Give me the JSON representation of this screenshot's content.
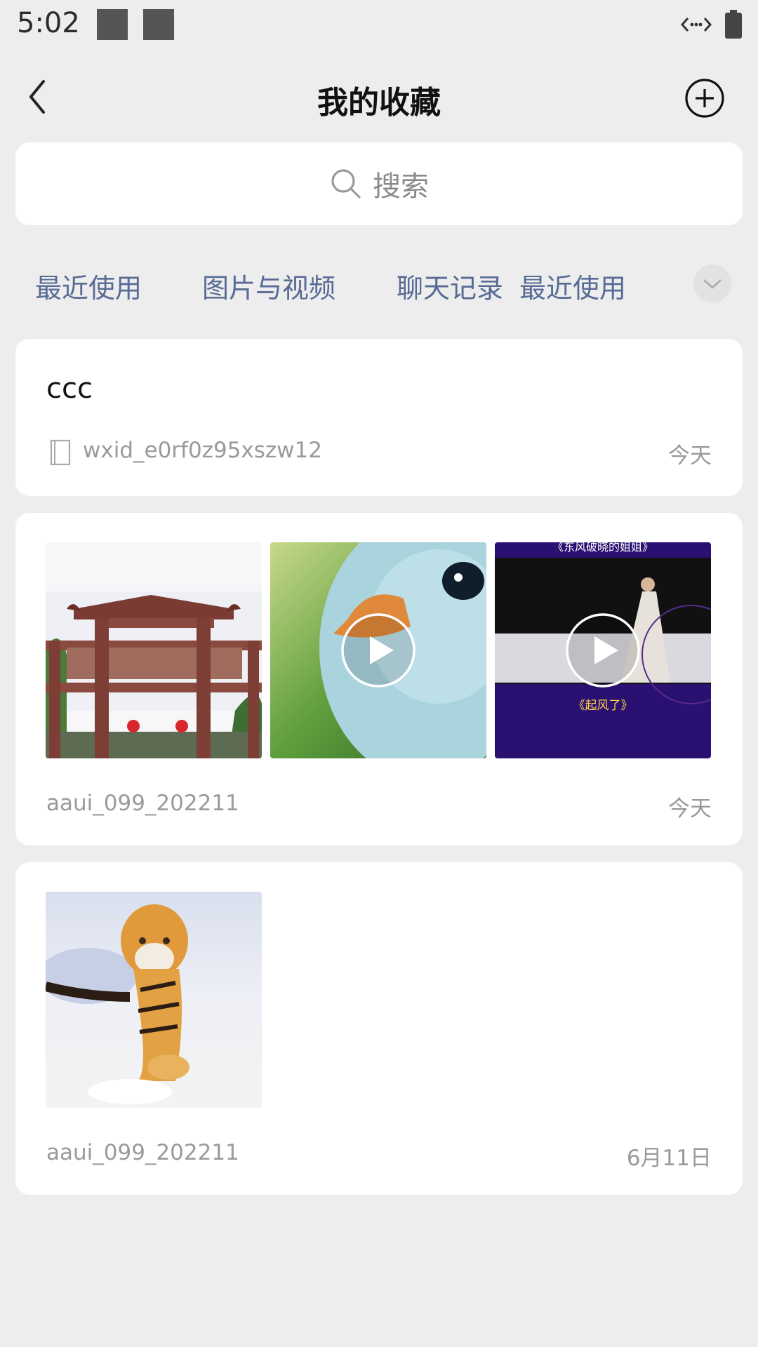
{
  "status": {
    "time": "5:02"
  },
  "header": {
    "title": "我的收藏"
  },
  "search": {
    "placeholder": "搜索"
  },
  "tabs": [
    {
      "label": "最近使用"
    },
    {
      "label": "图片与视频"
    },
    {
      "label": "聊天记录"
    },
    {
      "label": "最近使用"
    }
  ],
  "items": [
    {
      "text": "ccc",
      "source": "wxid_e0rf0z95xszw12",
      "date": "今天"
    },
    {
      "source": "aaui_099_202211",
      "date": "今天",
      "media": [
        {
          "kind": "image",
          "subject": "archway"
        },
        {
          "kind": "video",
          "subject": "duckling"
        },
        {
          "kind": "video",
          "subject": "stage",
          "top_caption": "《东风破晓的姐姐》",
          "caption": "《起风了》"
        }
      ]
    },
    {
      "source": "aaui_099_202211",
      "date": "6月11日",
      "media": [
        {
          "kind": "image",
          "subject": "tiger"
        }
      ]
    }
  ],
  "colors": {
    "link": "#576b95",
    "background": "#ededed"
  }
}
